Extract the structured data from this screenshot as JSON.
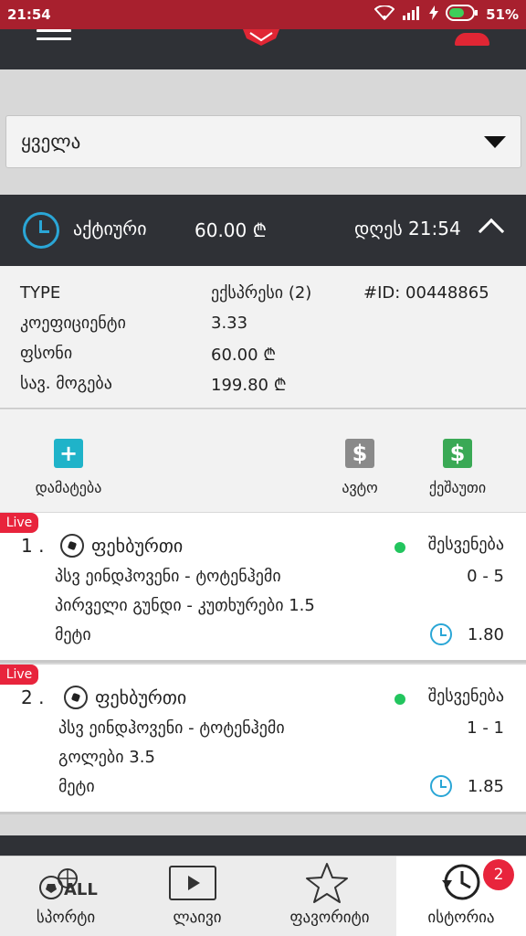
{
  "status_bar": {
    "time": "21:54",
    "battery": "51%"
  },
  "filter": {
    "selected": "ყველა"
  },
  "bet": {
    "status": "აქტიური",
    "amount": "60.00 ₾",
    "date": "დღეს 21:54",
    "details": [
      {
        "label": "TYPE",
        "value": "ექსპრესი (2)"
      },
      {
        "label": "კოეფიციენტი",
        "value": "3.33"
      },
      {
        "label": "ფსონი",
        "value": "60.00 ₾"
      },
      {
        "label": "სავ. მოგება",
        "value": "199.80 ₾"
      }
    ],
    "id": "#ID: 00448865"
  },
  "actions": {
    "add": {
      "label": "დამატება",
      "icon": "+"
    },
    "auto": {
      "label": "ავტო",
      "icon": "$"
    },
    "cashout": {
      "label": "ქეშაუთი",
      "icon": "$"
    }
  },
  "cards": [
    {
      "live": "Live",
      "number": "1 .",
      "sport": "ფეხბურთი",
      "result": "შესვენება",
      "match": "პსვ ეინდჰოვენი - ტოტენჰემი",
      "score": "0 - 5",
      "market": "პირველი გუნდი - კუთხურები 1.5",
      "selection": "მეტი",
      "odds": "1.80"
    },
    {
      "live": "Live",
      "number": "2 .",
      "sport": "ფეხბურთი",
      "result": "შესვენება",
      "match": "პსვ ეინდჰოვენი - ტოტენჰემი",
      "score": "1 - 1",
      "market": "გოლები 3.5",
      "selection": "მეტი",
      "odds": "1.85"
    }
  ],
  "nav": {
    "sports": {
      "label": "სპორტი",
      "icon_text": "ALL"
    },
    "live": {
      "label": "ლაივი"
    },
    "favorites": {
      "label": "ფავორიტი"
    },
    "history": {
      "label": "ისტორია",
      "badge": "2"
    }
  },
  "colors": {
    "status_bar": "#a8202e",
    "header": "#2f3136",
    "accent_blue": "#2aa6d6",
    "live_red": "#e8243c",
    "add_teal": "#1fb3c9",
    "auto_gray": "#8a8a8a",
    "cashout_green": "#3aa955",
    "break_green": "#22c55e"
  }
}
